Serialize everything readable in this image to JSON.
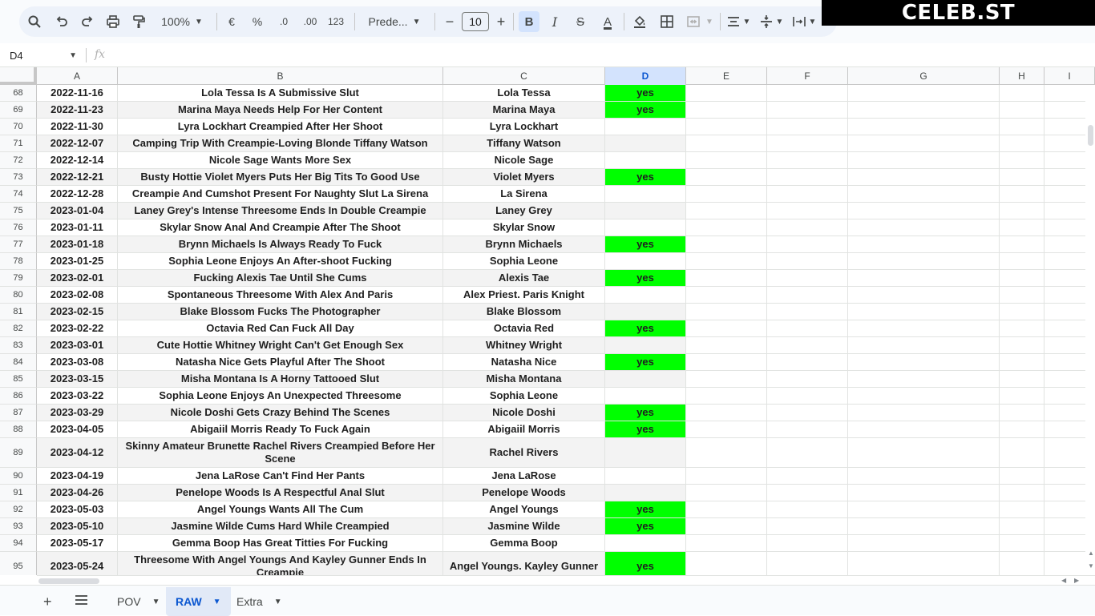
{
  "toolbar": {
    "zoom": "100%",
    "currency": "€",
    "percent": "%",
    "decrease_decimal": ".0",
    "increase_decimal": ".00",
    "number_format": "123",
    "font_name": "Prede...",
    "font_size": "10",
    "bold": "B",
    "italic": "I",
    "strikethrough": "S",
    "text_color": "A"
  },
  "logo": "CELEB.ST",
  "formula_bar": {
    "cell_ref": "D4",
    "fx": "fx"
  },
  "columns": [
    "A",
    "B",
    "C",
    "D",
    "E",
    "F",
    "G",
    "H",
    "I"
  ],
  "selected_column": "D",
  "rows": [
    {
      "num": "68",
      "date": "2022-11-16",
      "title": "Lola Tessa Is A Submissive Slut",
      "performer": "Lola Tessa",
      "flag": "yes"
    },
    {
      "num": "69",
      "date": "2022-11-23",
      "title": "Marina Maya Needs Help For Her Content",
      "performer": "Marina Maya",
      "flag": "yes"
    },
    {
      "num": "70",
      "date": "2022-11-30",
      "title": "Lyra Lockhart Creampied After Her Shoot",
      "performer": "Lyra Lockhart",
      "flag": ""
    },
    {
      "num": "71",
      "date": "2022-12-07",
      "title": "Camping Trip With Creampie-Loving Blonde Tiffany Watson",
      "performer": "Tiffany Watson",
      "flag": ""
    },
    {
      "num": "72",
      "date": "2022-12-14",
      "title": "Nicole Sage Wants More Sex",
      "performer": "Nicole Sage",
      "flag": ""
    },
    {
      "num": "73",
      "date": "2022-12-21",
      "title": "Busty Hottie Violet Myers Puts Her Big Tits To Good Use",
      "performer": "Violet Myers",
      "flag": "yes"
    },
    {
      "num": "74",
      "date": "2022-12-28",
      "title": "Creampie And Cumshot Present For Naughty Slut La Sirena",
      "performer": "La Sirena",
      "flag": ""
    },
    {
      "num": "75",
      "date": "2023-01-04",
      "title": "Laney Grey's Intense Threesome Ends In Double Creampie",
      "performer": "Laney Grey",
      "flag": ""
    },
    {
      "num": "76",
      "date": "2023-01-11",
      "title": "Skylar Snow Anal And Creampie After The Shoot",
      "performer": "Skylar Snow",
      "flag": ""
    },
    {
      "num": "77",
      "date": "2023-01-18",
      "title": "Brynn Michaels Is Always Ready To Fuck",
      "performer": "Brynn Michaels",
      "flag": "yes"
    },
    {
      "num": "78",
      "date": "2023-01-25",
      "title": "Sophia Leone Enjoys An After-shoot Fucking",
      "performer": "Sophia Leone",
      "flag": ""
    },
    {
      "num": "79",
      "date": "2023-02-01",
      "title": "Fucking Alexis Tae Until She Cums",
      "performer": "Alexis Tae",
      "flag": "yes"
    },
    {
      "num": "80",
      "date": "2023-02-08",
      "title": "Spontaneous Threesome With Alex And Paris",
      "performer": "Alex Priest. Paris Knight",
      "flag": ""
    },
    {
      "num": "81",
      "date": "2023-02-15",
      "title": "Blake Blossom Fucks The Photographer",
      "performer": "Blake Blossom",
      "flag": ""
    },
    {
      "num": "82",
      "date": "2023-02-22",
      "title": "Octavia Red Can Fuck All Day",
      "performer": "Octavia Red",
      "flag": "yes"
    },
    {
      "num": "83",
      "date": "2023-03-01",
      "title": "Cute Hottie Whitney Wright Can't Get Enough Sex",
      "performer": "Whitney Wright",
      "flag": ""
    },
    {
      "num": "84",
      "date": "2023-03-08",
      "title": "Natasha Nice Gets Playful After The Shoot",
      "performer": "Natasha Nice",
      "flag": "yes"
    },
    {
      "num": "85",
      "date": "2023-03-15",
      "title": "Misha Montana Is A Horny Tattooed Slut",
      "performer": "Misha Montana",
      "flag": ""
    },
    {
      "num": "86",
      "date": "2023-03-22",
      "title": "Sophia Leone Enjoys An Unexpected Threesome",
      "performer": "Sophia Leone",
      "flag": ""
    },
    {
      "num": "87",
      "date": "2023-03-29",
      "title": "Nicole Doshi Gets Crazy Behind The Scenes",
      "performer": "Nicole Doshi",
      "flag": "yes"
    },
    {
      "num": "88",
      "date": "2023-04-05",
      "title": "Abigaiil Morris Ready To Fuck Again",
      "performer": "Abigaiil Morris",
      "flag": "yes"
    },
    {
      "num": "89",
      "date": "2023-04-12",
      "title": "Skinny Amateur Brunette Rachel Rivers Creampied Before Her Scene",
      "performer": "Rachel Rivers",
      "flag": ""
    },
    {
      "num": "90",
      "date": "2023-04-19",
      "title": "Jena LaRose Can't Find Her Pants",
      "performer": "Jena LaRose",
      "flag": ""
    },
    {
      "num": "91",
      "date": "2023-04-26",
      "title": "Penelope Woods Is A Respectful Anal Slut",
      "performer": "Penelope Woods",
      "flag": ""
    },
    {
      "num": "92",
      "date": "2023-05-03",
      "title": "Angel Youngs Wants All The Cum",
      "performer": "Angel Youngs",
      "flag": "yes"
    },
    {
      "num": "93",
      "date": "2023-05-10",
      "title": "Jasmine Wilde Cums Hard While Creampied",
      "performer": "Jasmine Wilde",
      "flag": "yes"
    },
    {
      "num": "94",
      "date": "2023-05-17",
      "title": "Gemma Boop Has Great Titties For Fucking",
      "performer": "Gemma Boop",
      "flag": ""
    },
    {
      "num": "95",
      "date": "2023-05-24",
      "title": "Threesome With Angel Youngs And Kayley Gunner Ends In Creampie",
      "performer": "Angel Youngs. Kayley Gunner",
      "flag": "yes"
    }
  ],
  "sheet_tabs": [
    {
      "label": "POV",
      "active": false
    },
    {
      "label": "RAW",
      "active": true
    },
    {
      "label": "Extra",
      "active": false
    }
  ],
  "colors": {
    "yes_fill": "#00ff00",
    "alt_row": "#f3f3f3",
    "selected_header": "#d3e3fd",
    "active_tab_text": "#0b57d0"
  }
}
